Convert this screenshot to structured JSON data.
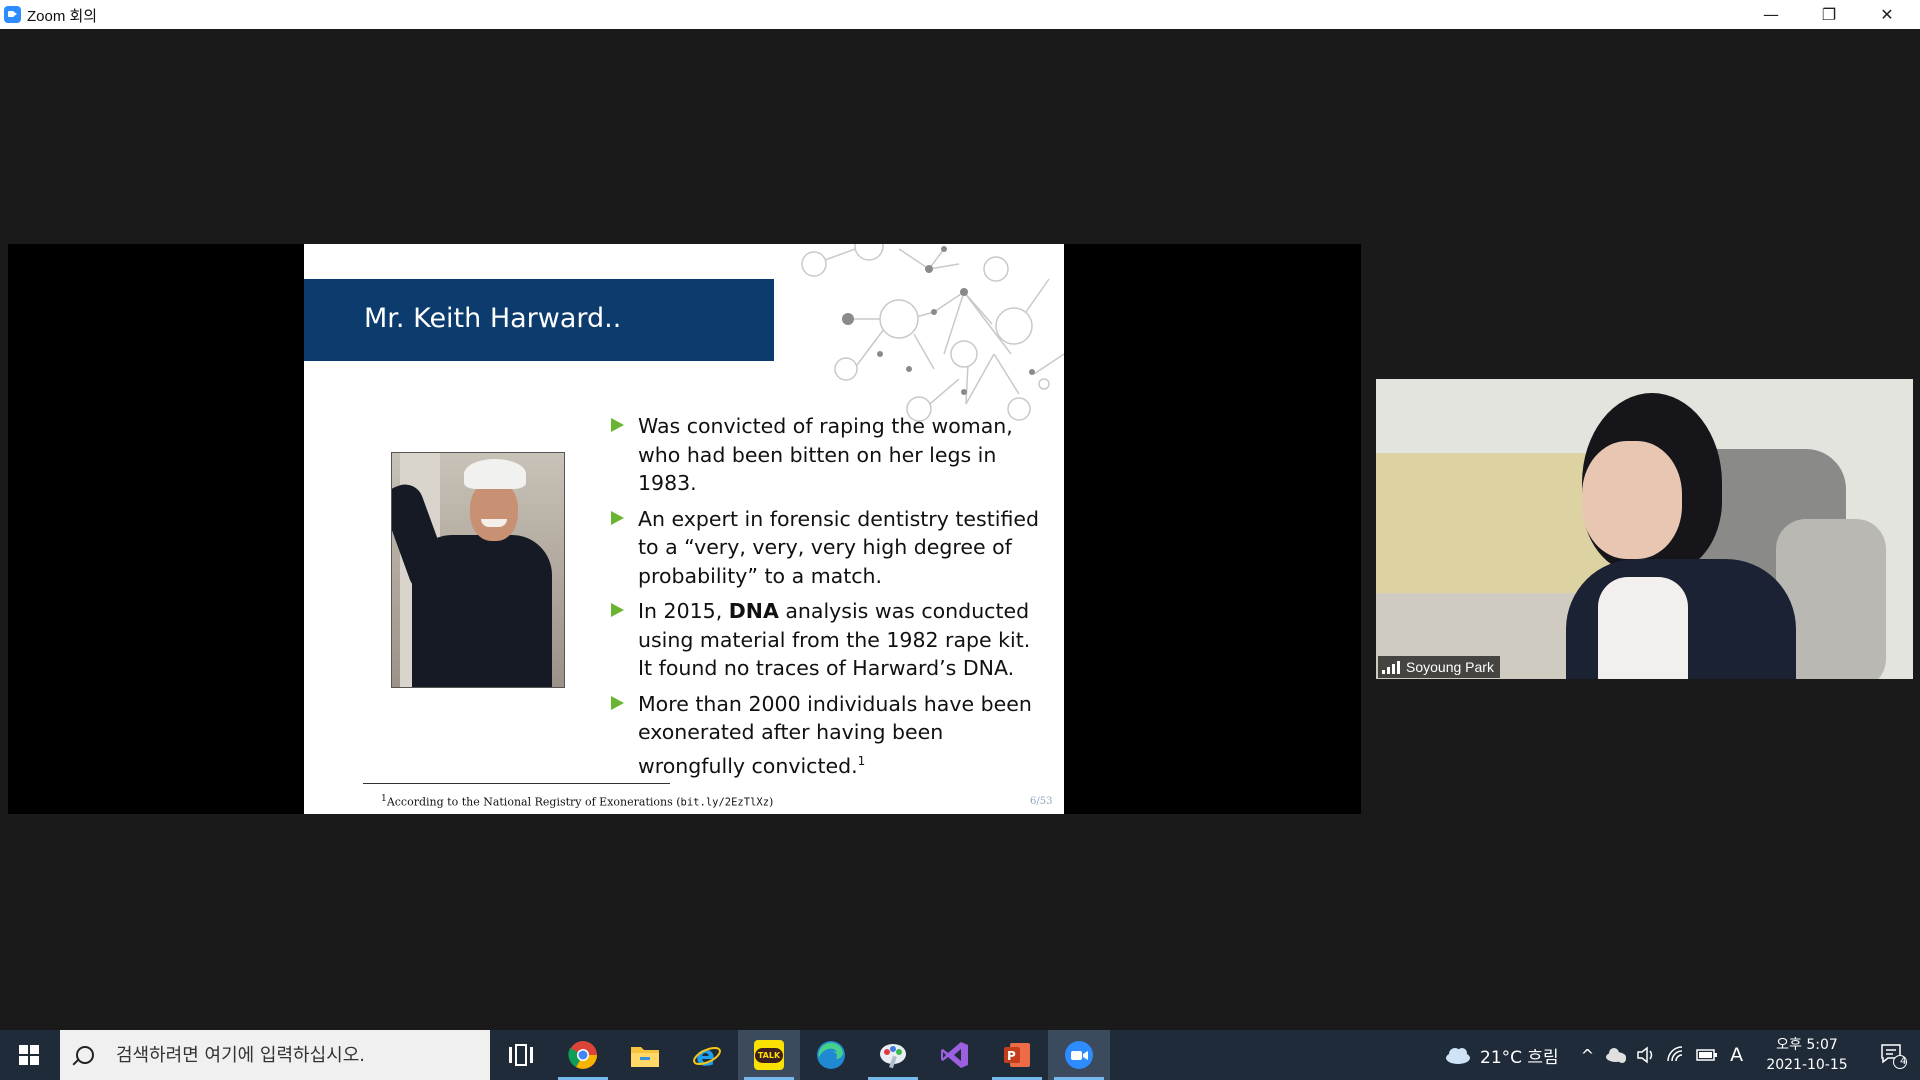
{
  "window": {
    "title": "Zoom 회의",
    "min_glyph": "—",
    "max_glyph": "❐",
    "close_glyph": "✕"
  },
  "slide": {
    "title": "Mr. Keith Harward..",
    "bullets": [
      {
        "text": "Was convicted of raping the woman, who had been bitten on her legs in 1983."
      },
      {
        "text": "An expert in forensic dentistry testified to a “very, very, very high degree of probability” to a match."
      },
      {
        "before": "In 2015, ",
        "bold": "DNA",
        "after": " analysis was conducted using material from the 1982 rape kit. It found no traces of Harward’s DNA."
      },
      {
        "text": "More than 2000 individuals have been exonerated after having been wrongfully convicted.",
        "sup": "1"
      }
    ],
    "footnote": {
      "mark": "1",
      "text": "According to the National Registry of Exonerations (",
      "link": "bit.ly/2EzTlXz",
      "close": ")"
    },
    "page": "6/53",
    "accent_color": "#0c3b6d",
    "bullet_color": "#6bb433"
  },
  "participant": {
    "name": "Soyoung Park"
  },
  "taskbar": {
    "search_placeholder": "검색하려면 여기에 입력하십시오.",
    "apps": [
      {
        "name": "task-view-icon"
      },
      {
        "name": "chrome-icon",
        "open": true
      },
      {
        "name": "file-explorer-icon"
      },
      {
        "name": "internet-explorer-icon"
      },
      {
        "name": "kakaotalk-icon",
        "label": "TALK",
        "open": true
      },
      {
        "name": "edge-icon"
      },
      {
        "name": "paint-icon",
        "open": true
      },
      {
        "name": "visual-studio-icon"
      },
      {
        "name": "powerpoint-icon",
        "open": true
      },
      {
        "name": "zoom-icon",
        "open": true,
        "active": true
      }
    ],
    "weather": "21°C 흐림",
    "ime": "A",
    "clock_ampm_time": "오후 5:07",
    "date": "2021-10-15",
    "notification_count": "4"
  }
}
